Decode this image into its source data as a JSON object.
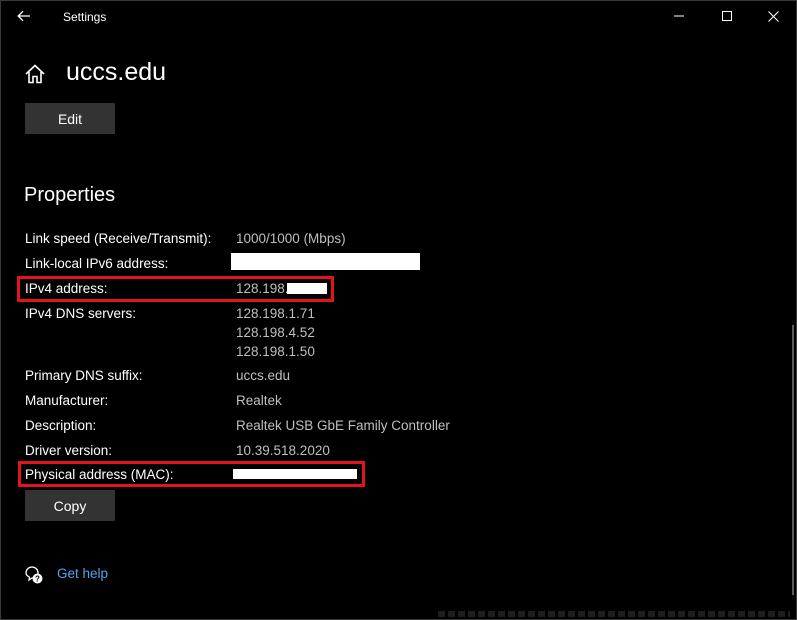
{
  "window": {
    "title": "Settings"
  },
  "page": {
    "title": "uccs.edu",
    "edit_label": "Edit",
    "copy_label": "Copy"
  },
  "properties": {
    "heading": "Properties",
    "link_speed": {
      "label": "Link speed (Receive/Transmit):",
      "value": "1000/1000 (Mbps)"
    },
    "ipv6": {
      "label": "Link-local IPv6 address:"
    },
    "ipv4": {
      "label": "IPv4 address:",
      "value_prefix": "128.198."
    },
    "dns_servers": {
      "label": "IPv4 DNS servers:",
      "values": [
        "128.198.1.71",
        "128.198.4.52",
        "128.198.1.50"
      ]
    },
    "dns_suffix": {
      "label": "Primary DNS suffix:",
      "value": "uccs.edu"
    },
    "manufacturer": {
      "label": "Manufacturer:",
      "value": "Realtek"
    },
    "description": {
      "label": "Description:",
      "value": "Realtek USB GbE Family Controller"
    },
    "driver_version": {
      "label": "Driver version:",
      "value": "10.39.518.2020"
    },
    "mac": {
      "label": "Physical address (MAC):"
    }
  },
  "help": {
    "label": "Get help"
  },
  "icons": {
    "back": "back-arrow-icon",
    "home": "home-icon",
    "minimize": "minimize-icon",
    "maximize": "maximize-icon",
    "close": "close-icon",
    "help": "chat-help-icon"
  },
  "colors": {
    "background": "#000000",
    "button": "#333333",
    "highlight": "#e3141c",
    "link": "#4ea6f0",
    "value_text": "#bfbfbf"
  }
}
